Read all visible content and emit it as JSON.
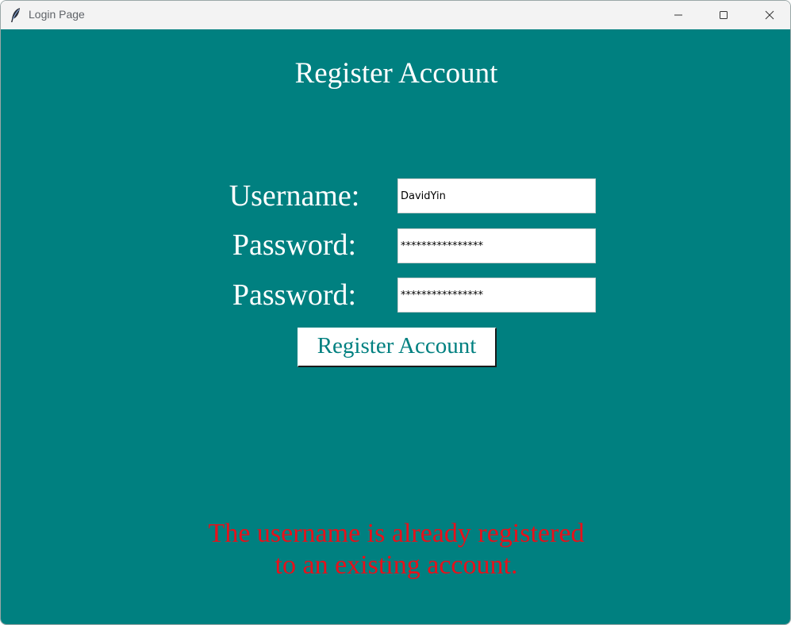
{
  "window": {
    "title": "Login Page",
    "icon": "feather-icon",
    "controls": [
      "minimize-icon",
      "maximize-icon",
      "close-icon"
    ]
  },
  "form": {
    "heading": "Register Account",
    "username_label": "Username:",
    "username_value": "DavidYin",
    "password_label": "Password:",
    "password_value": "****************",
    "confirm_label": "Password:",
    "confirm_value": "****************",
    "submit_label": "Register Account"
  },
  "error": {
    "line1": "The username is already registered",
    "line2": "to an existing account."
  },
  "colors": {
    "background": "#008080",
    "error": "#e8101a",
    "text": "#ffffff"
  }
}
